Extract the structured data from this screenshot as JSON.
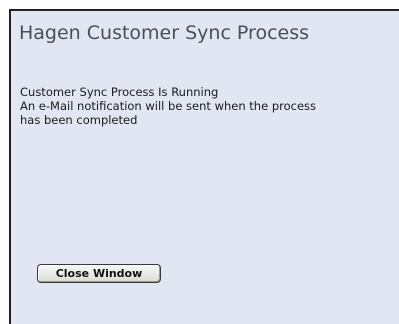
{
  "window": {
    "title": "Hagen Customer Sync Process",
    "status_line": "Customer Sync Process Is Running",
    "notice_line_1": "An e-Mail notification will be sent when the process",
    "notice_line_2": "has been completed",
    "close_button_label": "Close Window"
  },
  "colors": {
    "background": "#e2e6f3",
    "title_text": "#4d4d57"
  }
}
